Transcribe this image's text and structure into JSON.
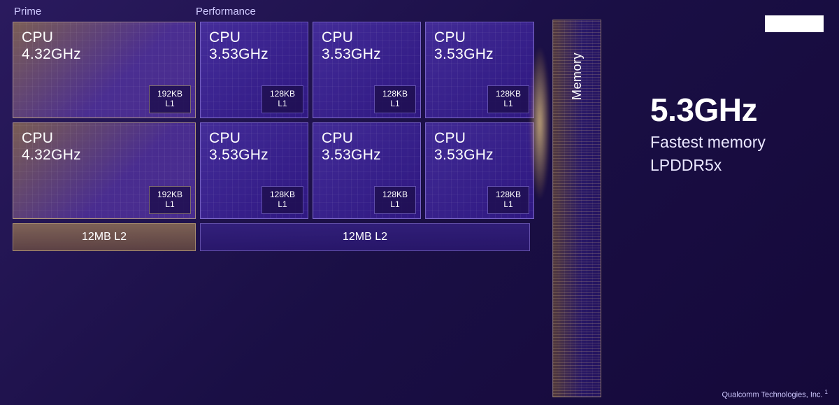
{
  "labels": {
    "prime": "Prime",
    "performance": "Performance"
  },
  "cores": {
    "prime": [
      {
        "title": "CPU",
        "freq": "4.32GHz",
        "l1_size": "192KB",
        "l1_label": "L1"
      },
      {
        "title": "CPU",
        "freq": "4.32GHz",
        "l1_size": "192KB",
        "l1_label": "L1"
      }
    ],
    "performance": [
      {
        "title": "CPU",
        "freq": "3.53GHz",
        "l1_size": "128KB",
        "l1_label": "L1"
      },
      {
        "title": "CPU",
        "freq": "3.53GHz",
        "l1_size": "128KB",
        "l1_label": "L1"
      },
      {
        "title": "CPU",
        "freq": "3.53GHz",
        "l1_size": "128KB",
        "l1_label": "L1"
      },
      {
        "title": "CPU",
        "freq": "3.53GHz",
        "l1_size": "128KB",
        "l1_label": "L1"
      },
      {
        "title": "CPU",
        "freq": "3.53GHz",
        "l1_size": "128KB",
        "l1_label": "L1"
      },
      {
        "title": "CPU",
        "freq": "3.53GHz",
        "l1_size": "128KB",
        "l1_label": "L1"
      }
    ]
  },
  "l2": {
    "prime": "12MB L2",
    "performance": "12MB L2"
  },
  "memory": {
    "label": "Memory"
  },
  "headline": {
    "big": "5.3GHz",
    "line1": "Fastest memory",
    "line2": "LPDDR5x"
  },
  "footer": {
    "text": "Qualcomm Technologies, Inc.",
    "sup": "1"
  }
}
